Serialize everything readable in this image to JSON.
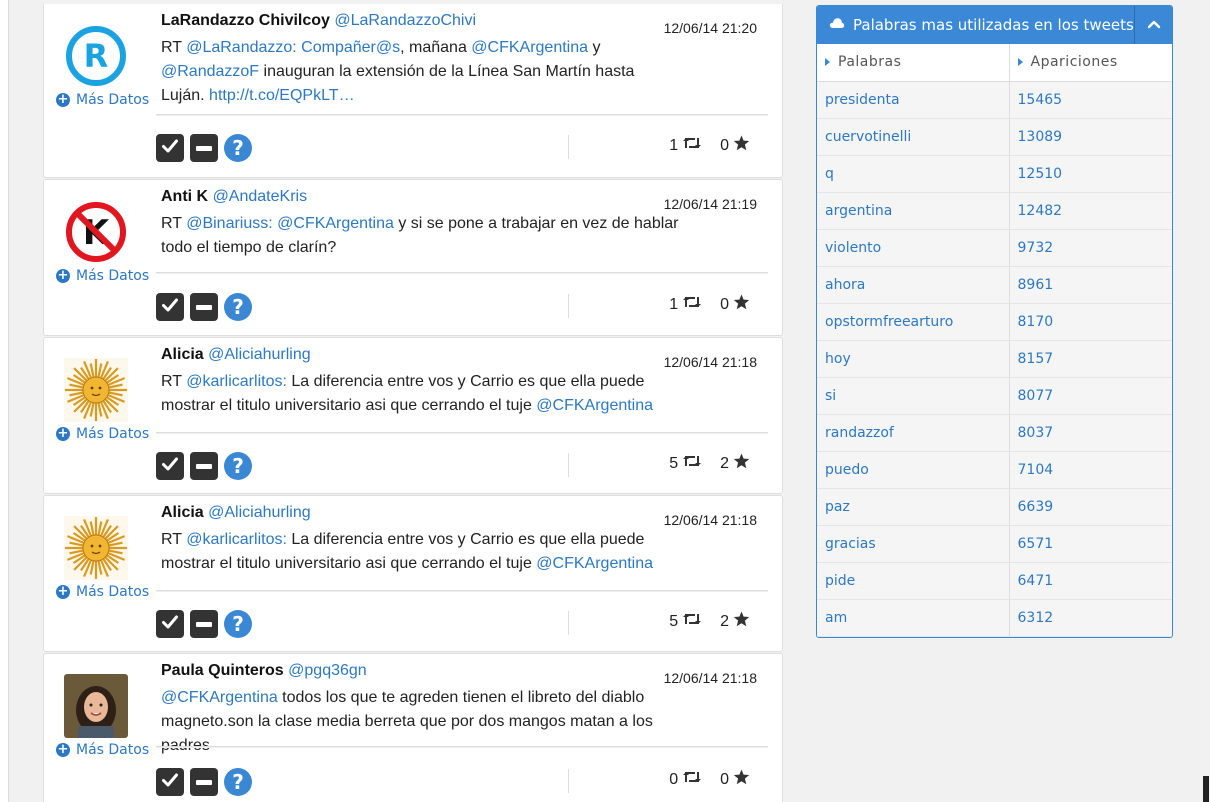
{
  "tweets": [
    {
      "name": "LaRandazzo Chivilcoy",
      "handle": "@LaRandazzoChivi",
      "date": "12/06/14 21:20",
      "avatar": "r-logo",
      "mas_datos": "Más Datos",
      "text": [
        {
          "t": "RT ",
          "link": false
        },
        {
          "t": "@LaRandazzo: Compañer@s",
          "link": true
        },
        {
          "t": ", mañana ",
          "link": false
        },
        {
          "t": "@CFKArgentina",
          "link": true
        },
        {
          "t": " y ",
          "link": false
        },
        {
          "t": "@RandazzoF",
          "link": true
        },
        {
          "t": " inauguran la extensión de la Línea San Martín hasta Luján. ",
          "link": false
        },
        {
          "t": "http://t.co/EQPkLT…",
          "link": true
        }
      ],
      "retweets": "1",
      "favorites": "0"
    },
    {
      "name": "Anti K",
      "handle": "@AndateKris",
      "date": "12/06/14 21:19",
      "avatar": "no-k-sign",
      "mas_datos": "Más Datos",
      "text": [
        {
          "t": "RT ",
          "link": false
        },
        {
          "t": "@Binariuss: @CFKArgentina",
          "link": true
        },
        {
          "t": " y si se pone a trabajar en vez de hablar todo el tiempo de clarín?",
          "link": false
        }
      ],
      "retweets": "1",
      "favorites": "0"
    },
    {
      "name": "Alicia",
      "handle": "@Aliciahurling",
      "date": "12/06/14 21:18",
      "avatar": "sun",
      "mas_datos": "Más Datos",
      "text": [
        {
          "t": "RT ",
          "link": false
        },
        {
          "t": "@karlicarlitos:",
          "link": true
        },
        {
          "t": " La diferencia entre vos y Carrio es que ella puede mostrar el titulo universitario asi que cerrando el tuje ",
          "link": false
        },
        {
          "t": "@CFKArgentina",
          "link": true
        }
      ],
      "retweets": "5",
      "favorites": "2"
    },
    {
      "name": "Alicia",
      "handle": "@Aliciahurling",
      "date": "12/06/14 21:18",
      "avatar": "sun",
      "mas_datos": "Más Datos",
      "text": [
        {
          "t": "RT ",
          "link": false
        },
        {
          "t": "@karlicarlitos:",
          "link": true
        },
        {
          "t": " La diferencia entre vos y Carrio es que ella puede mostrar el titulo universitario asi que cerrando el tuje ",
          "link": false
        },
        {
          "t": "@CFKArgentina",
          "link": true
        }
      ],
      "retweets": "5",
      "favorites": "2"
    },
    {
      "name": "Paula Quinteros",
      "handle": "@pgq36gn",
      "date": "12/06/14 21:18",
      "avatar": "photo",
      "mas_datos": "Más Datos",
      "text": [
        {
          "t": "@CFKArgentina",
          "link": true
        },
        {
          "t": " todos los que te agreden tienen el libreto del diablo magneto.son la clase media berreta que por dos mangos matan a los padres",
          "link": false
        }
      ],
      "retweets": "0",
      "favorites": "0"
    }
  ],
  "panel": {
    "title": "Palabras mas utilizadas en los tweets",
    "icon": "cloud-icon",
    "columns": [
      "Palabras",
      "Apariciones"
    ],
    "rows": [
      [
        "presidenta",
        "15465"
      ],
      [
        "cuervotinelli",
        "13089"
      ],
      [
        "q",
        "12510"
      ],
      [
        "argentina",
        "12482"
      ],
      [
        "violento",
        "9732"
      ],
      [
        "ahora",
        "8961"
      ],
      [
        "opstormfreearturo",
        "8170"
      ],
      [
        "hoy",
        "8157"
      ],
      [
        "si",
        "8077"
      ],
      [
        "randazzof",
        "8037"
      ],
      [
        "puedo",
        "7104"
      ],
      [
        "paz",
        "6639"
      ],
      [
        "gracias",
        "6571"
      ],
      [
        "pide",
        "6471"
      ],
      [
        "am",
        "6312"
      ]
    ]
  },
  "colors": {
    "accent": "#3b88d6",
    "link": "#2d78c2",
    "button_dark": "#333333"
  }
}
